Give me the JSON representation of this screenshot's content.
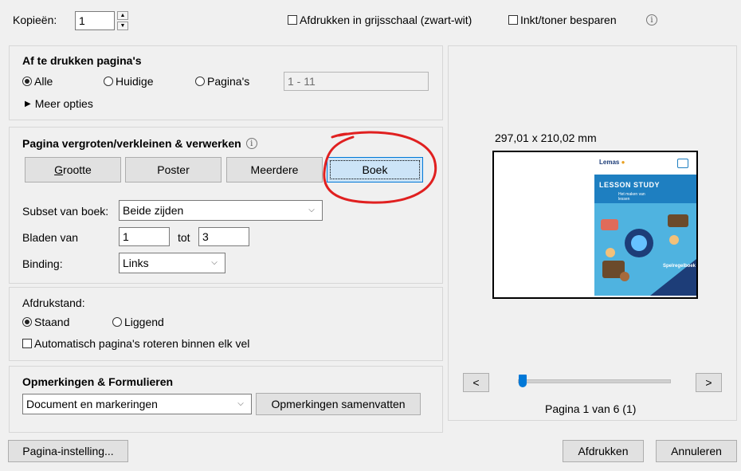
{
  "top": {
    "copies_label": "Kopieën:",
    "copies_value": "1",
    "grayscale_label": "Afdrukken in grijsschaal (zwart-wit)",
    "save_ink_label": "Inkt/toner besparen",
    "info_glyph": "i"
  },
  "pages_section": {
    "title": "Af te drukken pagina's",
    "radio_all": "Alle",
    "radio_current": "Huidige",
    "radio_pages": "Pagina's",
    "pages_value": "1 - 11",
    "more_options": "Meer opties"
  },
  "scaling_section": {
    "title": "Pagina vergroten/verkleinen & verwerken",
    "btn_size": "Grootte",
    "btn_size_underline": "G",
    "btn_size_rest": "rootte",
    "btn_poster": "Poster",
    "btn_multiple": "Meerdere",
    "btn_booklet": "Boek",
    "subset_label": "Subset van boek:",
    "subset_value": "Beide zijden",
    "sheets_label": "Bladen van",
    "sheets_from": "1",
    "sheets_to_label": "tot",
    "sheets_to": "3",
    "binding_label": "Binding:",
    "binding_value": "Links"
  },
  "orientation_section": {
    "title": "Afdrukstand:",
    "radio_portrait": "Staand",
    "radio_landscape": "Liggend",
    "auto_rotate": "Automatisch pagina's roteren binnen elk vel"
  },
  "comments_section": {
    "title": "Opmerkingen & Formulieren",
    "select_value": "Document en markeringen",
    "summarize_button": "Opmerkingen samenvatten"
  },
  "preview": {
    "dimensions": "297,01 x 210,02 mm",
    "prev_button": "<",
    "next_button": ">",
    "page_indicator": "Pagina 1 van 6 (1)",
    "slider_fraction": 0.0,
    "cover": {
      "logo_text": "Lemas",
      "title": "LESSON STUDY",
      "subtitle": "Het maken van lessen",
      "footer_title": "Spelregelboek",
      "accent_color": "#1e7fc1",
      "dark_color": "#1d3d78"
    }
  },
  "footer": {
    "page_setup_button": "Pagina-instelling...",
    "print_button": "Afdrukken",
    "cancel_button": "Annuleren"
  },
  "annotation_color": "#e02020"
}
